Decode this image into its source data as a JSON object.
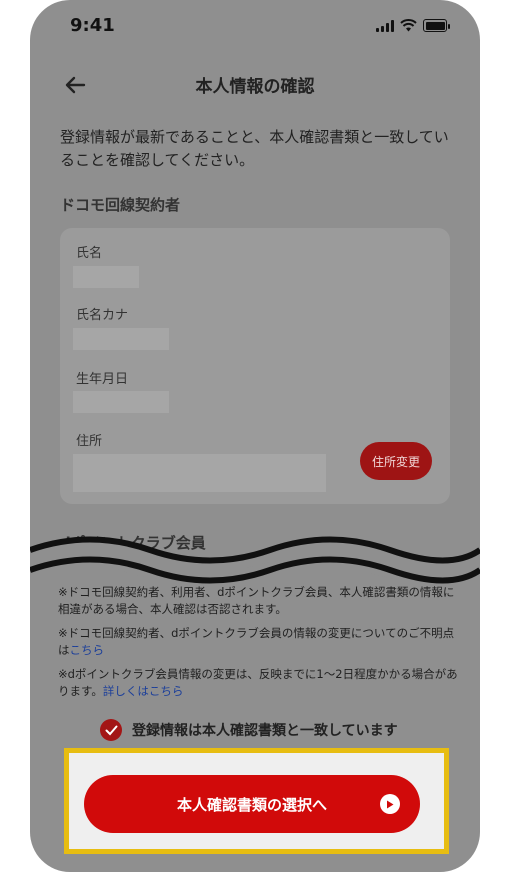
{
  "status": {
    "time": "9:41"
  },
  "header": {
    "title": "本人情報の確認"
  },
  "intro": "登録情報が最新であることと、本人確認書類と一致していることを確認してください。",
  "section_contractor": "ドコモ回線契約者",
  "fields": {
    "name": "氏名",
    "name_kana": "氏名カナ",
    "birthdate": "生年月日",
    "address": "住所"
  },
  "address_change_label": "住所変更",
  "section_points": "dポイントクラブ会員",
  "notes": {
    "note1": "※ドコモ回線契約者、利用者、dポイントクラブ会員、本人確認書類の情報に相違がある場合、本人確認は否認されます。",
    "note2_text": "※ドコモ回線契約者、dポイントクラブ会員の情報の変更についてのご不明点は",
    "note2_link": "こちら",
    "note3_text": "※dポイントクラブ会員情報の変更は、反映までに1〜2日程度かかる場合があります。",
    "note3_link": "詳しくはこちら"
  },
  "confirm_label": "登録情報は本人確認書類と一致しています",
  "cta_label": "本人確認書類の選択へ",
  "colors": {
    "accent": "#d10a0a",
    "highlight": "#e7bd11",
    "link": "#1c3f9a"
  }
}
